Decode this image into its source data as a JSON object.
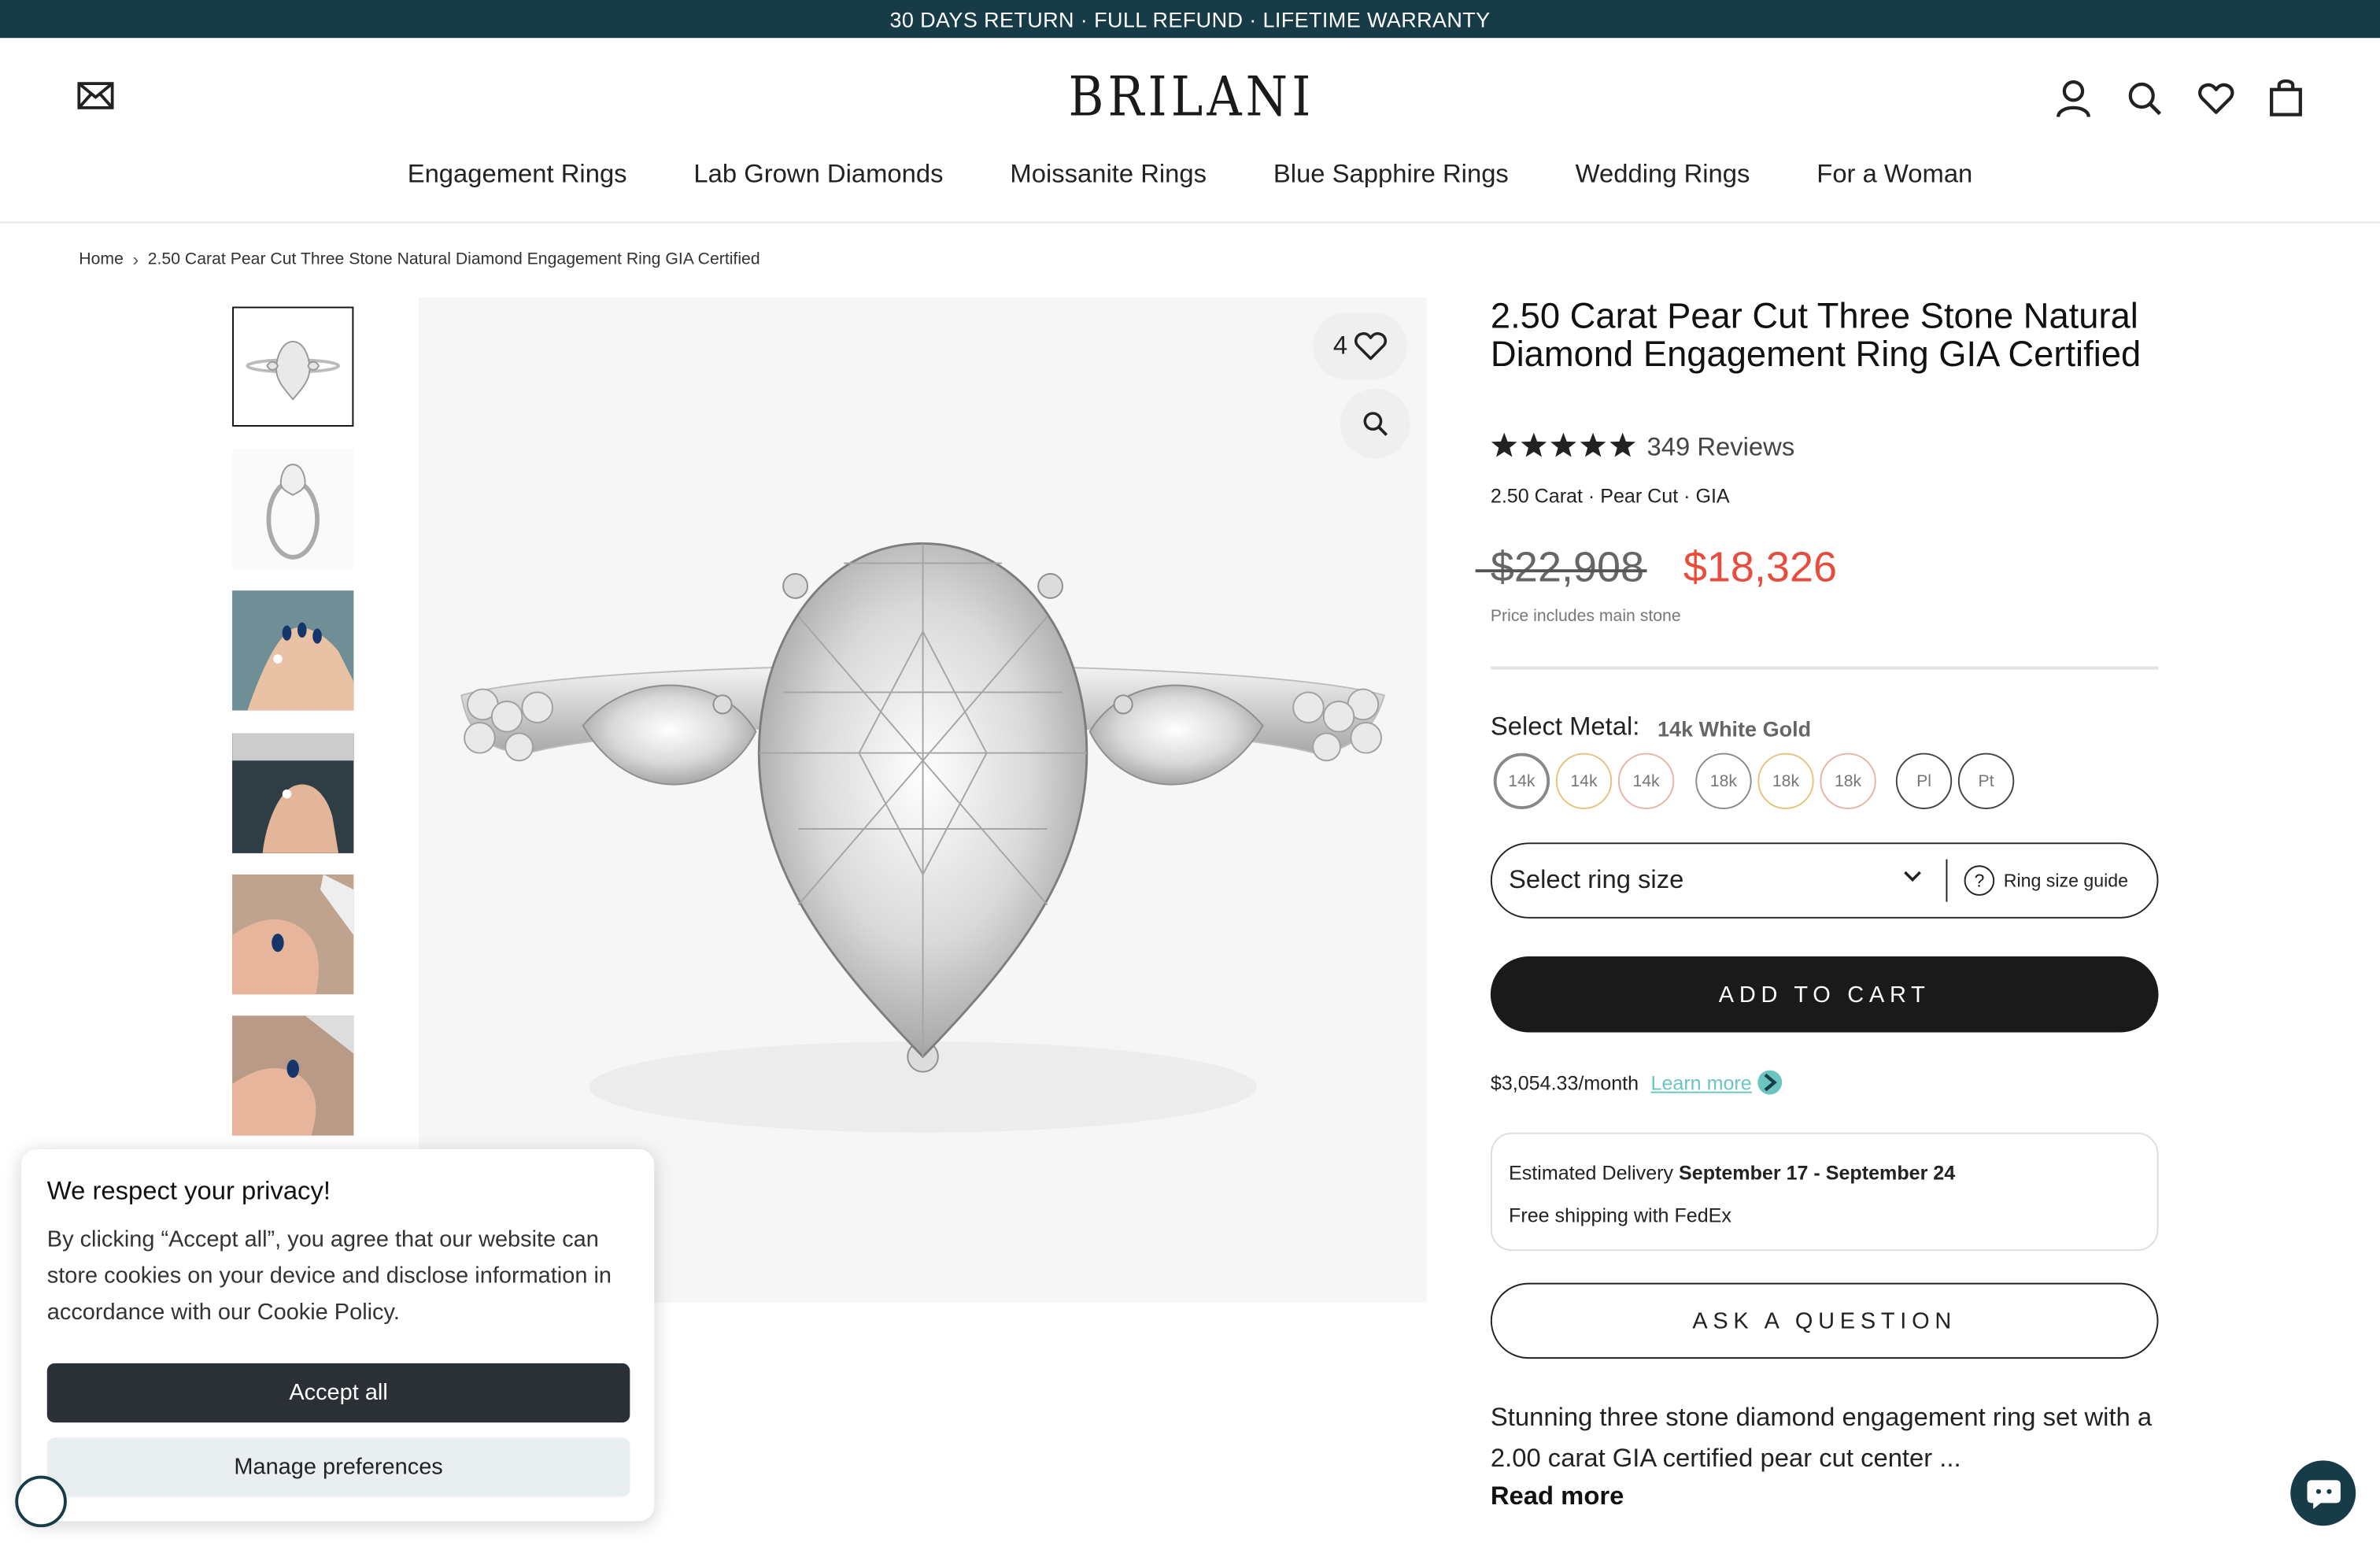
{
  "announcement": "30 DAYS RETURN · FULL REFUND · LIFETIME WARRANTY",
  "header": {
    "logo": "BRILANI",
    "nav": [
      "Engagement Rings",
      "Lab Grown Diamonds",
      "Moissanite Rings",
      "Blue Sapphire Rings",
      "Wedding Rings",
      "For a Woman"
    ],
    "icons": [
      "mail-icon",
      "account-icon",
      "search-icon",
      "heart-icon",
      "bag-icon"
    ]
  },
  "breadcrumb": {
    "home": "Home",
    "current": "2.50 Carat Pear Cut Three Stone Natural Diamond Engagement Ring GIA Certified"
  },
  "gallery": {
    "wishlist_count": "4"
  },
  "product": {
    "title": "2.50 Carat Pear Cut Three Stone Natural Diamond Engagement Ring GIA Certified",
    "rating": 5,
    "reviews": "349 Reviews",
    "specs": "2.50 Carat · Pear Cut · GIA",
    "old_price": "$22,908",
    "price": "$18,326",
    "price_note": "Price includes main stone",
    "metal_label": "Select Metal:",
    "metal_value": "14k White Gold",
    "metals": [
      {
        "label": "14k",
        "color": "#8a8a8a",
        "selected": true
      },
      {
        "label": "14k",
        "color": "#e6c27a"
      },
      {
        "label": "14k",
        "color": "#e8b3a8"
      },
      {
        "label": "18k",
        "color": "#8a8a8a"
      },
      {
        "label": "18k",
        "color": "#e6c27a"
      },
      {
        "label": "18k",
        "color": "#e8b3a8"
      },
      {
        "label": "Pl",
        "color": "#444444"
      },
      {
        "label": "Pt",
        "color": "#444444"
      }
    ],
    "size_placeholder": "Select ring size",
    "size_guide": "Ring size guide",
    "add_to_cart": "ADD TO CART",
    "monthly": "$3,054.33/month",
    "learn_more": "Learn more",
    "delivery_prefix": "Estimated Delivery",
    "delivery_dates": "September 17 - September 24",
    "shipping": "Free shipping with FedEx",
    "ask": "ASK A QUESTION",
    "description": "Stunning three stone diamond engagement ring set with a 2.00 carat GIA certified pear cut center ...",
    "read_more": "Read more"
  },
  "cookie": {
    "title": "We respect your privacy!",
    "body": "By clicking “Accept all”, you agree that our website can store cookies on your device and disclose information in accordance with our Cookie Policy.",
    "accept": "Accept all",
    "manage": "Manage preferences"
  },
  "colors": {
    "announcement_bg": "#173c48",
    "sale_price": "#e74c3c",
    "learn_more": "#6cc4c1",
    "button_dark": "#1a1a1a"
  }
}
